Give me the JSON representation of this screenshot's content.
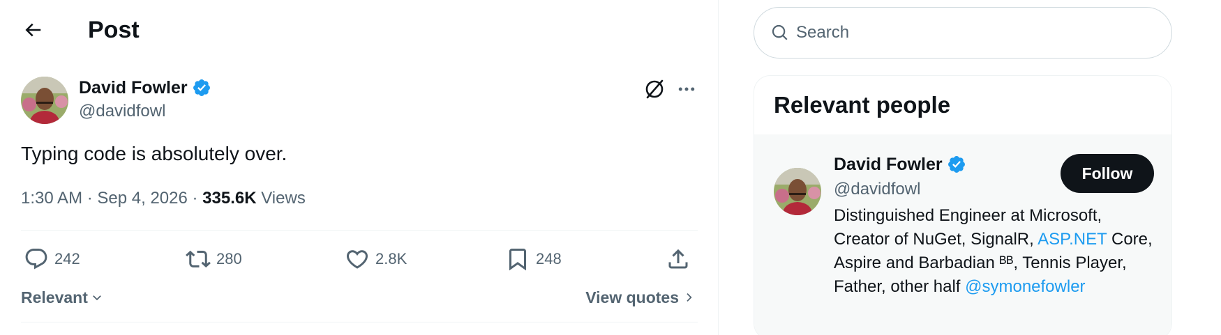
{
  "header": {
    "title": "Post"
  },
  "post": {
    "author_name": "David Fowler",
    "author_handle": "@davidfowl",
    "text": "Typing code is absolutely over.",
    "time": "1:30 AM",
    "separator1": " · ",
    "date": "Sep 4, 2026",
    "separator2": " · ",
    "views_count": "335.6K",
    "views_label": " Views",
    "replies": "242",
    "reposts": "280",
    "likes": "2.8K",
    "bookmarks": "248"
  },
  "sort": {
    "label": "Relevant"
  },
  "quotes": {
    "label": "View quotes"
  },
  "sidebar": {
    "search": {
      "placeholder": "Search"
    },
    "relevant_people": {
      "title": "Relevant people",
      "person": {
        "name": "David Fowler",
        "handle": "@davidfowl",
        "follow_label": "Follow",
        "bio_part1": "Distinguished Engineer at Microsoft, Creator of NuGet, SignalR, ",
        "bio_link1": "ASP.NET",
        "bio_part2": " Core, Aspire and Barbadian ᴮᴮ, Tennis Player, Father, other half ",
        "bio_link2": "@symonefowler"
      }
    }
  },
  "colors": {
    "accent": "#1d9bf0",
    "text_primary": "#0f1419",
    "text_secondary": "#536471",
    "border": "#eff3f4"
  },
  "icons": [
    "back-arrow-icon",
    "verified-badge-icon",
    "grok-icon",
    "more-icon",
    "reply-icon",
    "repost-icon",
    "like-icon",
    "bookmark-icon",
    "share-icon",
    "chevron-down-icon",
    "chevron-right-icon",
    "search-icon"
  ]
}
